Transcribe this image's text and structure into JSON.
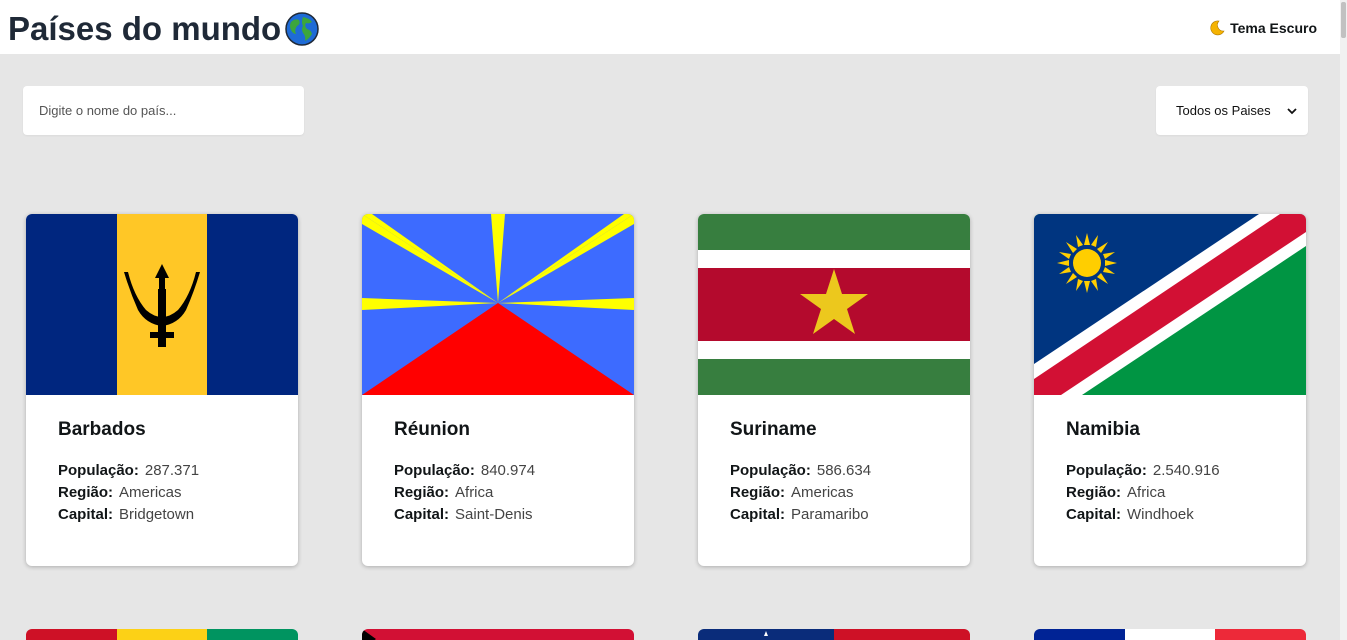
{
  "header": {
    "title": "Países do mundo",
    "theme_toggle_label": "Tema Escuro"
  },
  "search": {
    "placeholder": "Digite o nome do país..."
  },
  "filter": {
    "selected": "Todos os Paises"
  },
  "labels": {
    "population": "População:",
    "region": "Região:",
    "capital": "Capital:"
  },
  "countries": [
    {
      "name": "Barbados",
      "population": "287.371",
      "region": "Americas",
      "capital": "Bridgetown",
      "flag_icon": "barbados-flag"
    },
    {
      "name": "Réunion",
      "population": "840.974",
      "region": "Africa",
      "capital": "Saint-Denis",
      "flag_icon": "reunion-flag"
    },
    {
      "name": "Suriname",
      "population": "586.634",
      "region": "Americas",
      "capital": "Paramaribo",
      "flag_icon": "suriname-flag"
    },
    {
      "name": "Namibia",
      "population": "2.540.916",
      "region": "Africa",
      "capital": "Windhoek",
      "flag_icon": "namibia-flag"
    }
  ]
}
